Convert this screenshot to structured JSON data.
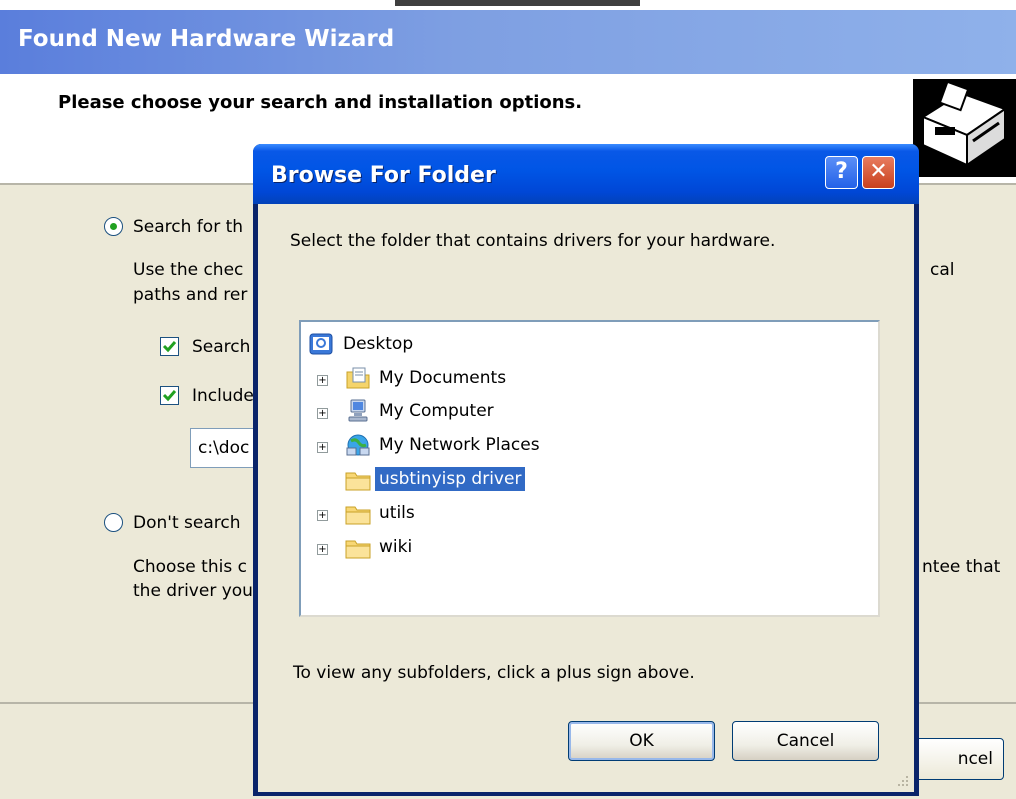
{
  "wizard": {
    "title": "Found New Hardware Wizard",
    "heading": "Please choose your search and installation options.",
    "option_search_label": "Search for th",
    "option_search_desc_1": "Use the chec",
    "option_search_desc_1_right": "cal",
    "option_search_desc_2": "paths and rer",
    "check_search_label": "Search",
    "check_include_label": "Include",
    "path_value": "c:\\doc",
    "option_dont_search_label": "Don't search",
    "option_dont_desc_1": "Choose this c",
    "option_dont_desc_1_right": "ntee that",
    "option_dont_desc_2": "the driver you",
    "cancel_label": "ncel"
  },
  "dialog": {
    "title": "Browse For Folder",
    "help_label": "?",
    "close_label": "✕",
    "instruction": "Select the folder that contains drivers for your hardware.",
    "tree": [
      {
        "label": "Desktop",
        "icon": "desktop-icon",
        "expandable": false,
        "selected": false
      },
      {
        "label": "My Documents",
        "icon": "my-documents-icon",
        "expandable": true,
        "selected": false
      },
      {
        "label": "My Computer",
        "icon": "my-computer-icon",
        "expandable": true,
        "selected": false
      },
      {
        "label": "My Network Places",
        "icon": "network-places-icon",
        "expandable": true,
        "selected": false
      },
      {
        "label": "usbtinyisp driver",
        "icon": "folder-icon",
        "expandable": false,
        "selected": true
      },
      {
        "label": "utils",
        "icon": "folder-icon",
        "expandable": true,
        "selected": false
      },
      {
        "label": "wiki",
        "icon": "folder-icon",
        "expandable": true,
        "selected": false
      }
    ],
    "hint": "To view any subfolders, click a plus sign above.",
    "ok_label": "OK",
    "cancel_label": "Cancel"
  },
  "colors": {
    "titlebar_blue": "#0055e5",
    "selection": "#316ac5",
    "window_face": "#ece9d8",
    "radio_dot": "#21a121"
  }
}
